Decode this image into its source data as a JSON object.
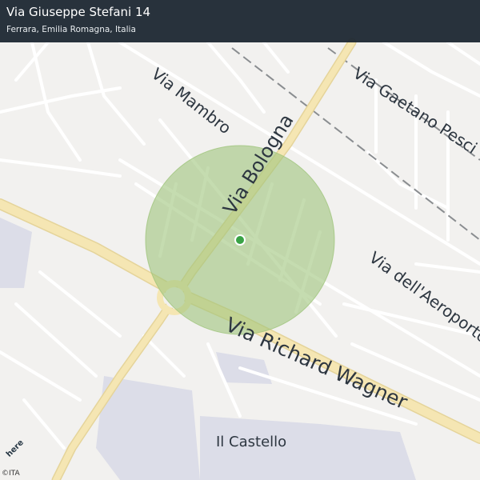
{
  "header": {
    "title": "Via Giuseppe Stefani 14",
    "subtitle": "Ferrara, Emilia Romagna, Italia"
  },
  "map": {
    "labels": {
      "via_mambro": "Via  Mambro",
      "via_bologna": "Via Bologna",
      "via_gaetano": "Via  Gaetano  Pesci",
      "via_aeroporto": "Via  dell'Aeroporto",
      "via_wagner": "Via  Richard  Wagner",
      "il_castello": "Il Castello"
    },
    "colors": {
      "background": "#f2f1ef",
      "major_road": "#f5e6b3",
      "minor_road": "#ffffff",
      "radius_fill": "#9fc47c",
      "marker": "#3aa346",
      "commercial_area": "#dcdde8",
      "header": "#1c2732"
    },
    "marker_icon": "location-dot-icon"
  },
  "footer": {
    "logo": "here",
    "copyright": "©ITA"
  }
}
